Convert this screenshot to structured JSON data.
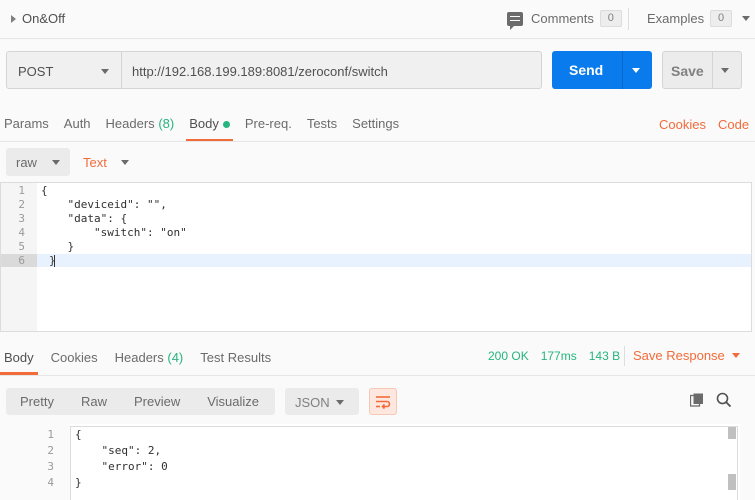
{
  "header": {
    "title": "On&Off",
    "comments_label": "Comments",
    "comments_count": "0",
    "examples_label": "Examples",
    "examples_count": "0"
  },
  "request": {
    "method": "POST",
    "url": "http://192.168.199.189:8081/zeroconf/switch",
    "send_label": "Send",
    "save_label": "Save"
  },
  "req_tabs": {
    "params": "Params",
    "auth": "Auth",
    "headers": "Headers",
    "headers_count": "(8)",
    "body": "Body",
    "prereq": "Pre-req.",
    "tests": "Tests",
    "settings": "Settings",
    "cookies": "Cookies",
    "code": "Code"
  },
  "body_mode": {
    "mode": "raw",
    "content_type": "Text"
  },
  "request_body": {
    "lines": [
      "{",
      "    \"deviceid\": \"\",",
      "    \"data\": {",
      "        \"switch\": \"on\"",
      "    }",
      "}"
    ],
    "line_numbers": [
      "1",
      "2",
      "3",
      "4",
      "5",
      "6"
    ]
  },
  "response": {
    "tabs": {
      "body": "Body",
      "cookies": "Cookies",
      "headers": "Headers",
      "headers_count": "(4)",
      "tests": "Test Results"
    },
    "status": "200 OK",
    "time": "177ms",
    "size": "143 B",
    "save_label": "Save Response",
    "views": [
      "Pretty",
      "Raw",
      "Preview",
      "Visualize"
    ],
    "format": "JSON",
    "lines": [
      "{",
      "    \"seq\": 2,",
      "    \"error\": 0",
      "}"
    ],
    "line_numbers": [
      "1",
      "2",
      "3",
      "4"
    ]
  },
  "colors": {
    "accent": "#f26b3a",
    "send": "#097bed",
    "success": "#26b47f"
  },
  "icons": {
    "triangle": "caret-right-icon",
    "comment": "comment-icon",
    "copy": "copy-icon",
    "search": "search-icon",
    "wrap": "wrap-lines-icon"
  }
}
